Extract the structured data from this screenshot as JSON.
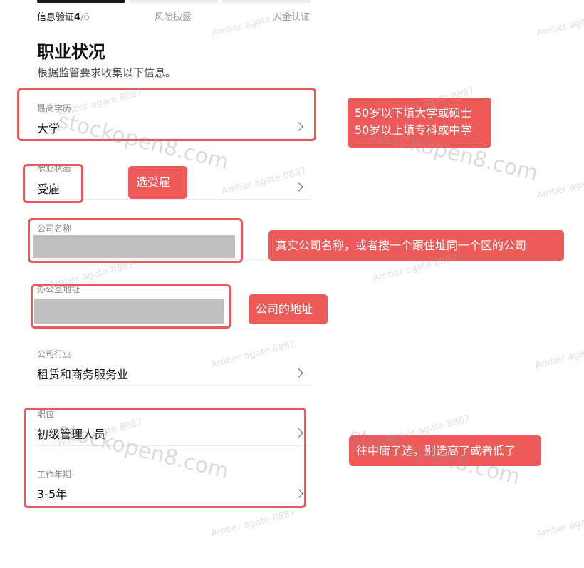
{
  "steps": [
    {
      "label": "信息验证",
      "current": "4",
      "total": "/6"
    },
    {
      "label": "风险披露"
    },
    {
      "label": "入金认证"
    }
  ],
  "page": {
    "title": "职业状况",
    "subtitle": "根据监管要求收集以下信息。"
  },
  "form": {
    "education": {
      "label": "最高学历",
      "value": "大学"
    },
    "employment_status": {
      "label": "职业状态",
      "value": "受雇"
    },
    "company_name": {
      "label": "公司名称"
    },
    "office_address": {
      "label": "办公室地址"
    },
    "industry": {
      "label": "公司行业",
      "value": "租赁和商务服务业"
    },
    "position": {
      "label": "职位",
      "value": "初级管理人员"
    },
    "years": {
      "label": "工作年期",
      "value": "3-5年"
    }
  },
  "annotations": {
    "education_note_1": "50岁以下填大学或硕士",
    "education_note_2": "50岁以上填专科或中学",
    "employment_note": "选受雇",
    "company_note": "真实公司名称，或者搜一个跟住址同一个区的公司",
    "address_note": "公司的地址",
    "position_note": "往中庸了选，别选高了或者低了"
  },
  "watermarks": {
    "site": "stockopen8.com",
    "author": "Amber agate 8887"
  },
  "colors": {
    "accent": "#e85a5a",
    "note_bg": "#ec5a5a",
    "step_active": "#1a1a1a",
    "step_inactive": "#eeeeee",
    "redaction": "#bfbfbf"
  }
}
